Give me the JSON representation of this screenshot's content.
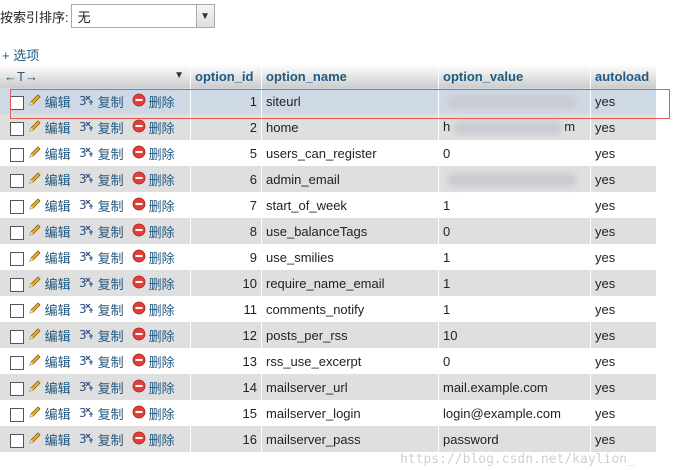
{
  "sort": {
    "label": "按索引排序:",
    "value": "无"
  },
  "options_link": "+ 选项",
  "columns": [
    "option_id",
    "option_name",
    "option_value",
    "autoload"
  ],
  "actions": {
    "edit": "编辑",
    "copy": "复制",
    "delete": "删除"
  },
  "rows": [
    {
      "id": "1",
      "name": "siteurl",
      "value": "",
      "autoload": "yes",
      "blurred": true
    },
    {
      "id": "2",
      "name": "home",
      "value": "h",
      "value_tail": "m",
      "autoload": "yes",
      "blurred": true
    },
    {
      "id": "5",
      "name": "users_can_register",
      "value": "0",
      "autoload": "yes"
    },
    {
      "id": "6",
      "name": "admin_email",
      "value": "",
      "autoload": "yes",
      "blurred": true
    },
    {
      "id": "7",
      "name": "start_of_week",
      "value": "1",
      "autoload": "yes"
    },
    {
      "id": "8",
      "name": "use_balanceTags",
      "value": "0",
      "autoload": "yes"
    },
    {
      "id": "9",
      "name": "use_smilies",
      "value": "1",
      "autoload": "yes"
    },
    {
      "id": "10",
      "name": "require_name_email",
      "value": "1",
      "autoload": "yes"
    },
    {
      "id": "11",
      "name": "comments_notify",
      "value": "1",
      "autoload": "yes"
    },
    {
      "id": "12",
      "name": "posts_per_rss",
      "value": "10",
      "autoload": "yes"
    },
    {
      "id": "13",
      "name": "rss_use_excerpt",
      "value": "0",
      "autoload": "yes"
    },
    {
      "id": "14",
      "name": "mailserver_url",
      "value": "mail.example.com",
      "autoload": "yes"
    },
    {
      "id": "15",
      "name": "mailserver_login",
      "value": "login@example.com",
      "autoload": "yes"
    },
    {
      "id": "16",
      "name": "mailserver_pass",
      "value": "password",
      "autoload": "yes"
    }
  ],
  "watermark": "https://blog.csdn.net/kaylion_",
  "colors": {
    "link": "#235a81",
    "row_even": "#dfdfdf",
    "row_selected": "#cfd9e6",
    "delete_icon": "#e0403a",
    "edit_icon": "#e8b23a"
  }
}
